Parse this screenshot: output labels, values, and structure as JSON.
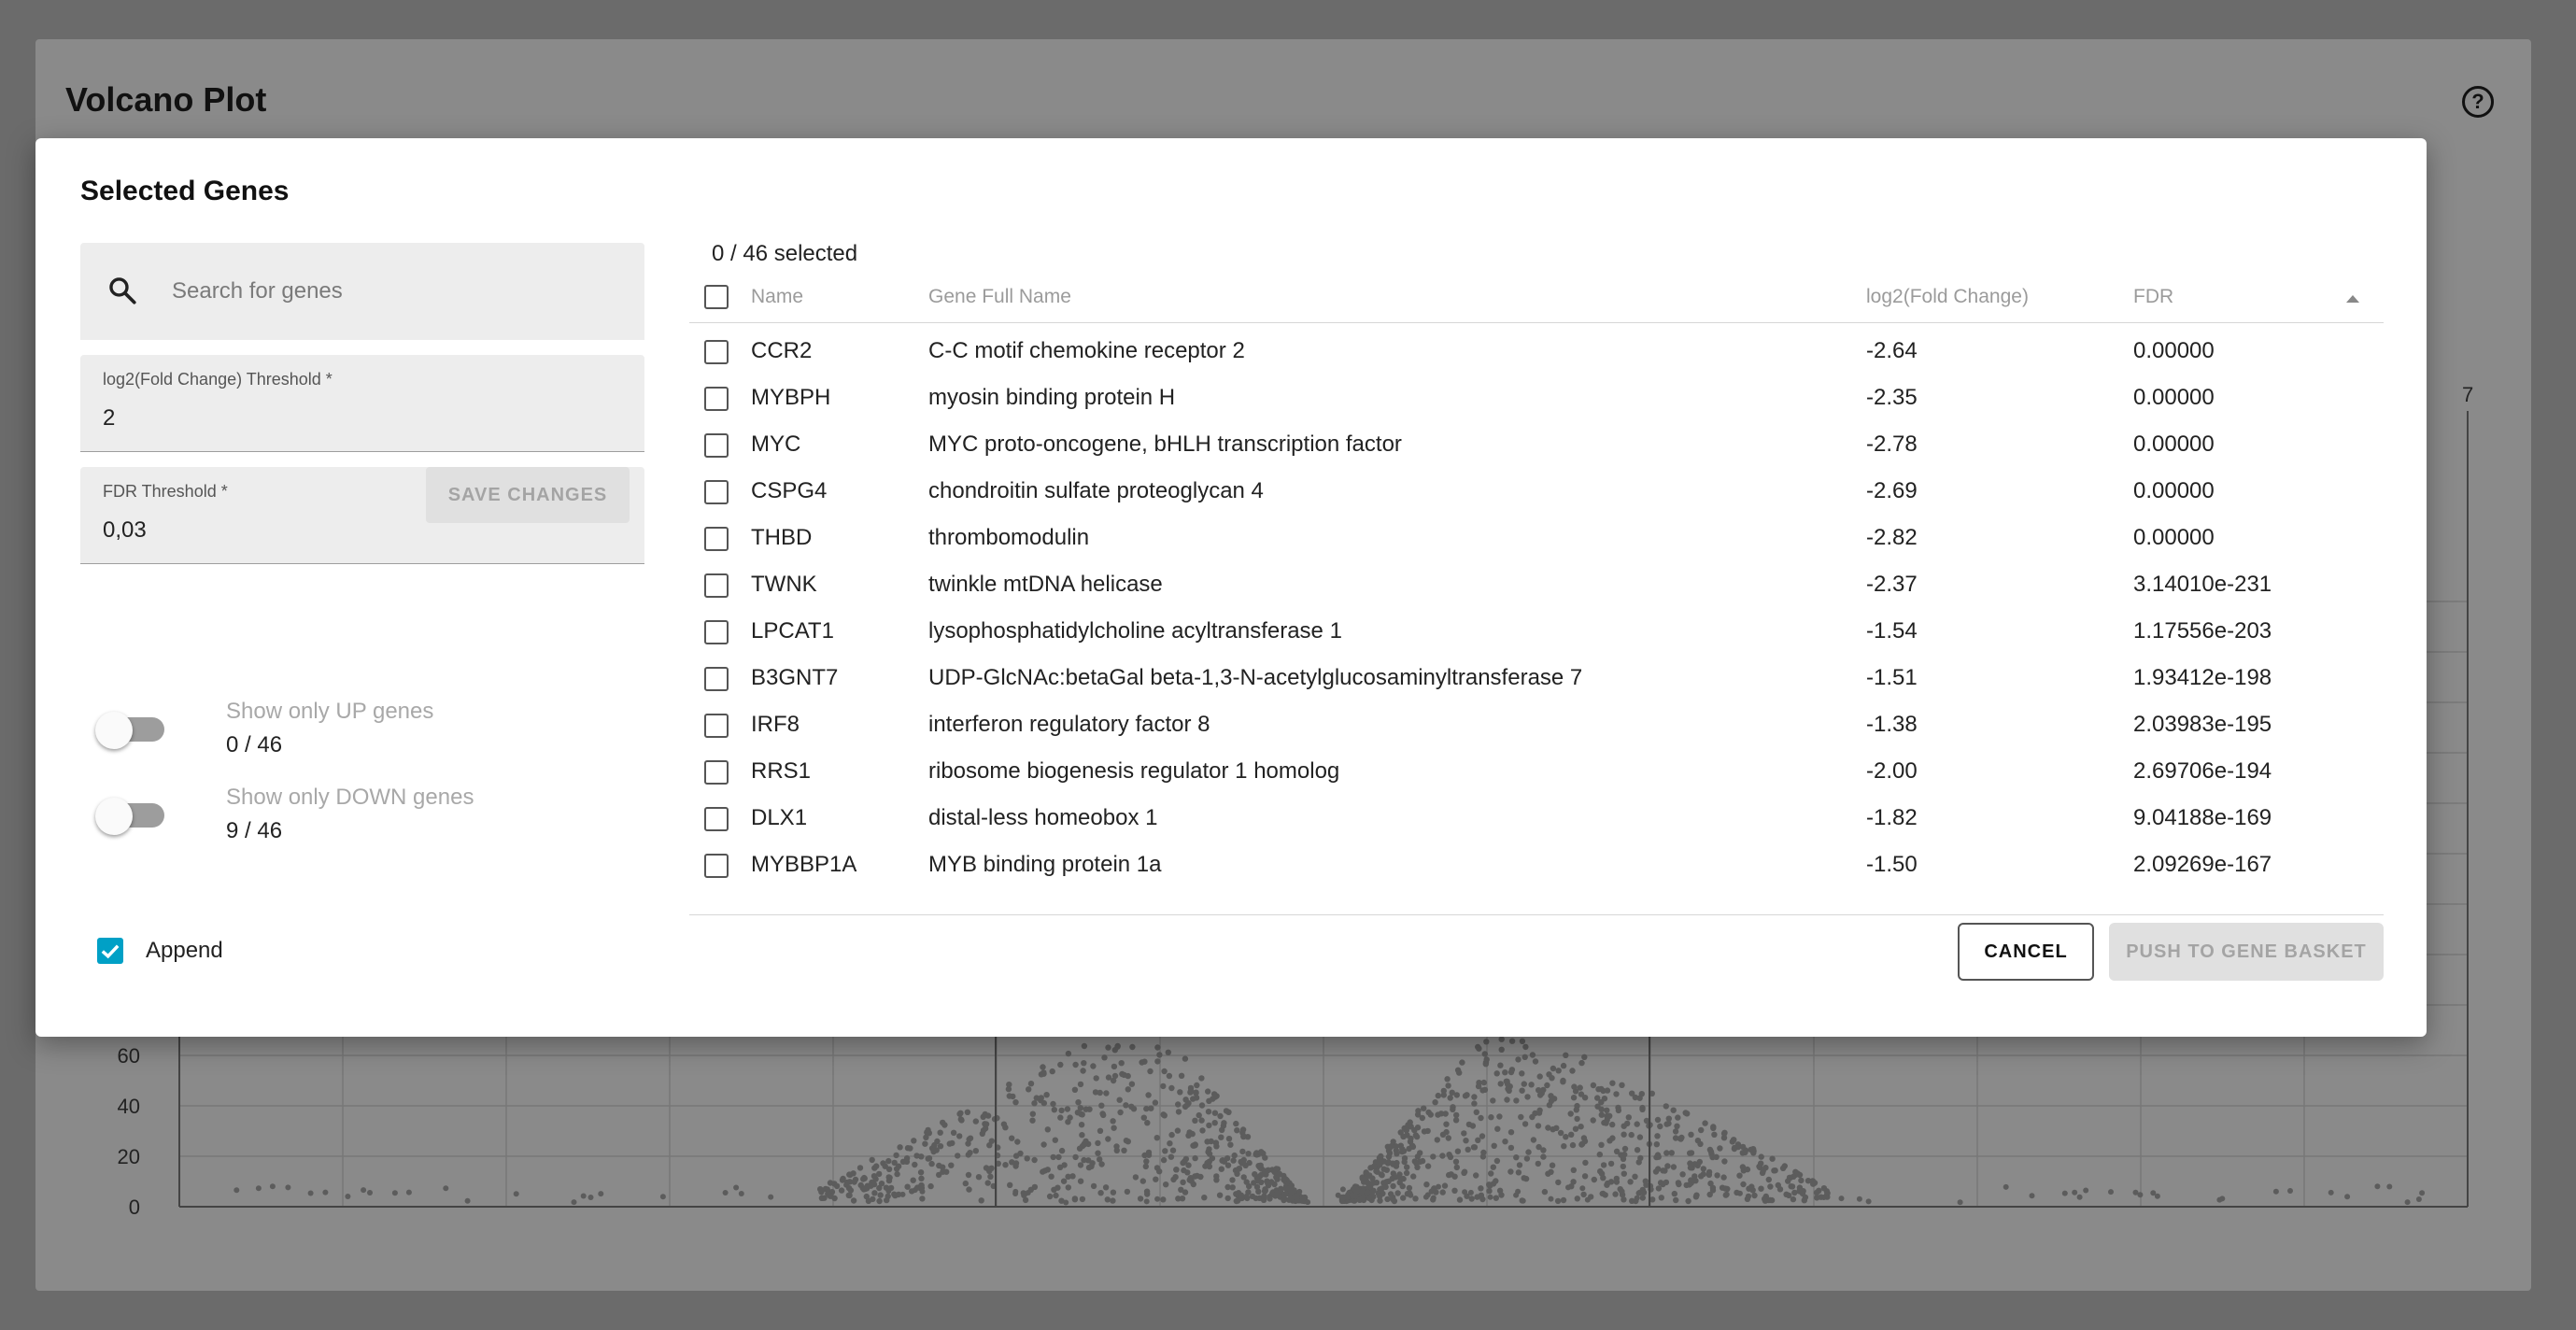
{
  "background": {
    "title": "Volcano Plot",
    "help_icon": "help-circle-icon",
    "y_ticks": [
      "60",
      "40",
      "20",
      "0"
    ],
    "x_tick_fragment": "7"
  },
  "dialog": {
    "title": "Selected Genes",
    "search": {
      "placeholder": "Search for genes",
      "value": "",
      "icon": "search-icon"
    },
    "fc_threshold": {
      "label": "log2(Fold Change) Threshold *",
      "value": "2"
    },
    "fdr_threshold": {
      "label": "FDR Threshold *",
      "value": "0,03"
    },
    "save_label": "SAVE CHANGES",
    "toggle_up": {
      "label": "Show only UP genes",
      "count": "0 / 46",
      "on": false
    },
    "toggle_down": {
      "label": "Show only DOWN genes",
      "count": "9 / 46",
      "on": false
    },
    "append": {
      "label": "Append",
      "checked": true,
      "color": "#00a0c6"
    },
    "cancel_label": "CANCEL",
    "push_label": "PUSH TO GENE BASKET"
  },
  "table": {
    "selected_text": "0 / 46 selected",
    "columns": [
      "Name",
      "Gene Full Name",
      "log2(Fold Change)",
      "FDR"
    ],
    "sort_column": "FDR",
    "rows": [
      {
        "name": "CCR2",
        "full": "C-C motif chemokine receptor 2",
        "fc": "-2.64",
        "fdr": "0.00000"
      },
      {
        "name": "MYBPH",
        "full": "myosin binding protein H",
        "fc": "-2.35",
        "fdr": "0.00000"
      },
      {
        "name": "MYC",
        "full": "MYC proto-oncogene, bHLH transcription factor",
        "fc": "-2.78",
        "fdr": "0.00000"
      },
      {
        "name": "CSPG4",
        "full": "chondroitin sulfate proteoglycan 4",
        "fc": "-2.69",
        "fdr": "0.00000"
      },
      {
        "name": "THBD",
        "full": "thrombomodulin",
        "fc": "-2.82",
        "fdr": "0.00000"
      },
      {
        "name": "TWNK",
        "full": "twinkle mtDNA helicase",
        "fc": "-2.37",
        "fdr": "3.14010e-231"
      },
      {
        "name": "LPCAT1",
        "full": "lysophosphatidylcholine acyltransferase 1",
        "fc": "-1.54",
        "fdr": "1.17556e-203"
      },
      {
        "name": "B3GNT7",
        "full": "UDP-GlcNAc:betaGal beta-1,3-N-acetylglucosaminyltransferase 7",
        "fc": "-1.51",
        "fdr": "1.93412e-198"
      },
      {
        "name": "IRF8",
        "full": "interferon regulatory factor 8",
        "fc": "-1.38",
        "fdr": "2.03983e-195"
      },
      {
        "name": "RRS1",
        "full": "ribosome biogenesis regulator 1 homolog",
        "fc": "-2.00",
        "fdr": "2.69706e-194"
      },
      {
        "name": "DLX1",
        "full": "distal-less homeobox 1",
        "fc": "-1.82",
        "fdr": "9.04188e-169"
      },
      {
        "name": "MYBBP1A",
        "full": "MYB binding protein 1a",
        "fc": "-1.50",
        "fdr": "2.09269e-167"
      }
    ]
  }
}
